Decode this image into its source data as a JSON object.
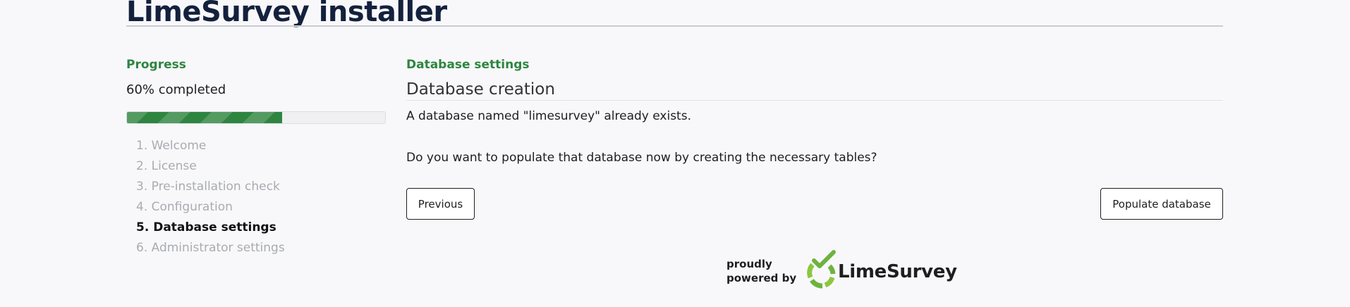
{
  "header": {
    "title": "LimeSurvey installer"
  },
  "progress": {
    "heading": "Progress",
    "completed_text": "60% completed",
    "percent": 60,
    "color": "#2e8540"
  },
  "steps": [
    {
      "label": "1. Welcome",
      "active": false
    },
    {
      "label": "2. License",
      "active": false
    },
    {
      "label": "3. Pre-installation check",
      "active": false
    },
    {
      "label": "4. Configuration",
      "active": false
    },
    {
      "label": "5. Database settings",
      "active": true
    },
    {
      "label": "6. Administrator settings",
      "active": false
    }
  ],
  "main": {
    "section_heading": "Database settings",
    "subheading": "Database creation",
    "message_exists": "A database named \"limesurvey\" already exists.",
    "message_question": "Do you want to populate that database now by creating the necessary tables?",
    "previous_label": "Previous",
    "populate_label": "Populate database"
  },
  "footer": {
    "powered_line1": "proudly",
    "powered_line2": "powered by",
    "logo_text": "LimeSurvey",
    "logo_icon": "limesurvey-logo-icon",
    "logo_color": "#8dc63f"
  }
}
